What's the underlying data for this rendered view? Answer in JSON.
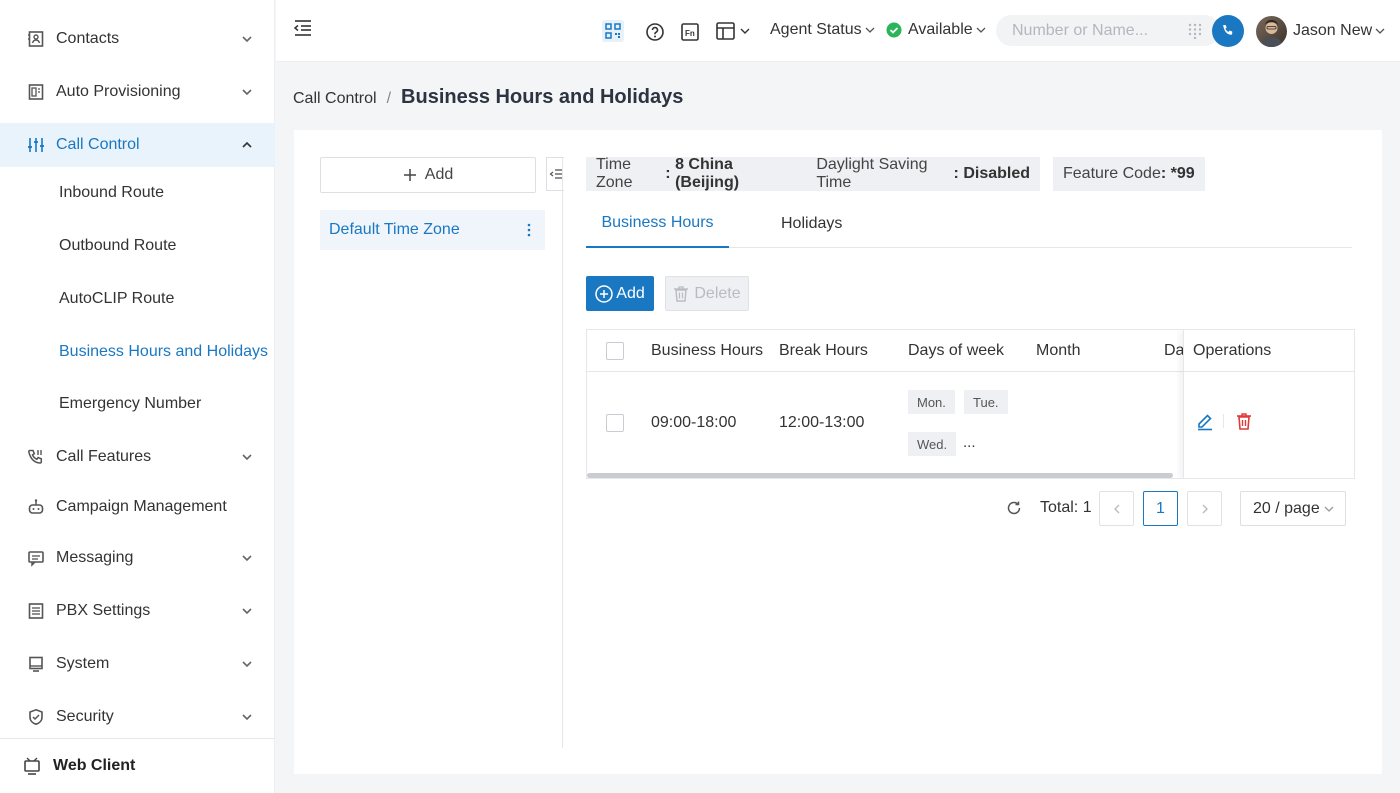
{
  "sidebar": {
    "items": [
      {
        "label": "Contacts",
        "icon": "contacts-icon"
      },
      {
        "label": "Auto Provisioning",
        "icon": "auto-provisioning-icon"
      },
      {
        "label": "Call Control",
        "icon": "sliders-icon"
      },
      {
        "label": "Call Features",
        "icon": "phone-settings-icon"
      },
      {
        "label": "Campaign Management",
        "icon": "robot-icon"
      },
      {
        "label": "Messaging",
        "icon": "message-icon"
      },
      {
        "label": "PBX Settings",
        "icon": "pbx-settings-icon"
      },
      {
        "label": "System",
        "icon": "monitor-icon"
      },
      {
        "label": "Security",
        "icon": "shield-icon"
      }
    ],
    "sub_items": [
      "Inbound Route",
      "Outbound Route",
      "AutoCLIP Route",
      "Business Hours and Holidays",
      "Emergency Number"
    ],
    "web_client": "Web Client"
  },
  "topbar": {
    "agent_status": "Agent Status",
    "available": "Available",
    "search_placeholder": "Number or Name...",
    "user_name": "Jason New"
  },
  "breadcrumb": {
    "parent": "Call Control",
    "separator": "/",
    "title": "Business Hours and Holidays"
  },
  "left_panel": {
    "add_label": "Add",
    "time_zones": [
      "Default Time Zone"
    ]
  },
  "info": {
    "time_zone_label": "Time Zone",
    "time_zone_value": "8 China (Beijing)",
    "dst_label": "Daylight Saving Time",
    "dst_value": "Disabled",
    "feature_code_label": "Feature Code",
    "feature_code_value": "*99"
  },
  "tabs": [
    "Business Hours",
    "Holidays"
  ],
  "toolbar": {
    "add": "Add",
    "delete": "Delete"
  },
  "table": {
    "columns": [
      "Business Hours",
      "Break Hours",
      "Days of week",
      "Month",
      "Da",
      "Operations"
    ],
    "rows": [
      {
        "business_hours": "09:00-18:00",
        "break_hours": "12:00-13:00",
        "days": [
          "Mon.",
          "Tue.",
          "Wed."
        ],
        "more": "..."
      }
    ]
  },
  "pagination": {
    "total_label": "Total: 1",
    "current_page": "1",
    "page_size": "20 / page"
  },
  "colors": {
    "accent": "#1a78c2",
    "status_green": "#2bb45a",
    "danger": "#e03a3a"
  }
}
